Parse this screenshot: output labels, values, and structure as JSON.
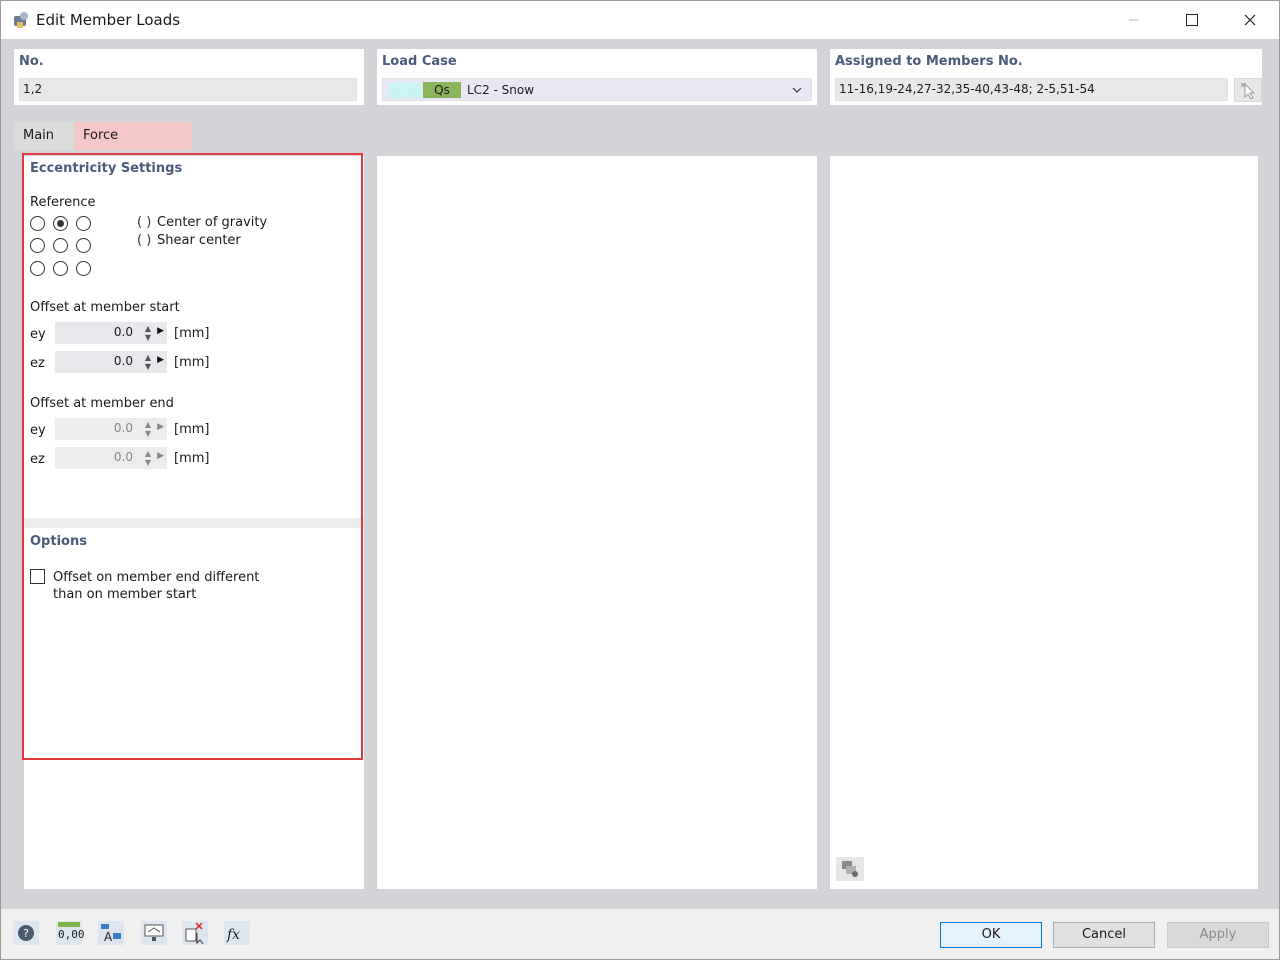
{
  "window": {
    "title": "Edit Member Loads"
  },
  "header": {
    "no": {
      "label": "No.",
      "value": "1,2"
    },
    "load_case": {
      "label": "Load Case",
      "badge": "Qs",
      "value": "LC2 - Snow"
    },
    "assigned": {
      "label": "Assigned to Members No.",
      "value": "11-16,19-24,27-32,35-40,43-48; 2-5,51-54"
    }
  },
  "tabs": [
    {
      "label": "Main",
      "active": false
    },
    {
      "label": "Force Eccentricity",
      "active": true
    }
  ],
  "eccentricity": {
    "title": "Eccentricity Settings",
    "reference_label": "Reference",
    "reference_grid_selected": "top-middle",
    "options": [
      "Center of gravity",
      "Shear center"
    ],
    "offset_start": {
      "label": "Offset at member start",
      "rows": [
        {
          "label": "ey",
          "value": "0.0",
          "unit": "[mm]"
        },
        {
          "label": "ez",
          "value": "0.0",
          "unit": "[mm]"
        }
      ]
    },
    "offset_end": {
      "label": "Offset at member end",
      "rows": [
        {
          "label": "ey",
          "value": "0.0",
          "unit": "[mm]"
        },
        {
          "label": "ez",
          "value": "0.0",
          "unit": "[mm]"
        }
      ]
    }
  },
  "options_section": {
    "title": "Options",
    "checkbox_label": "Offset on member end different than on member start",
    "checked": false
  },
  "buttons": {
    "ok": "OK",
    "cancel": "Cancel",
    "apply": "Apply"
  },
  "toolbar_icons": [
    "help-icon",
    "units-icon",
    "text-labels-icon",
    "display-icon",
    "member-select-icon",
    "formula-icon"
  ],
  "toolbar_units_text": "0,00",
  "colors": {
    "highlight": "#e03a3a",
    "section_title": "#4a5a7a",
    "tab_active": "#f4c8c8",
    "qs_badge": "#8ab55b"
  }
}
